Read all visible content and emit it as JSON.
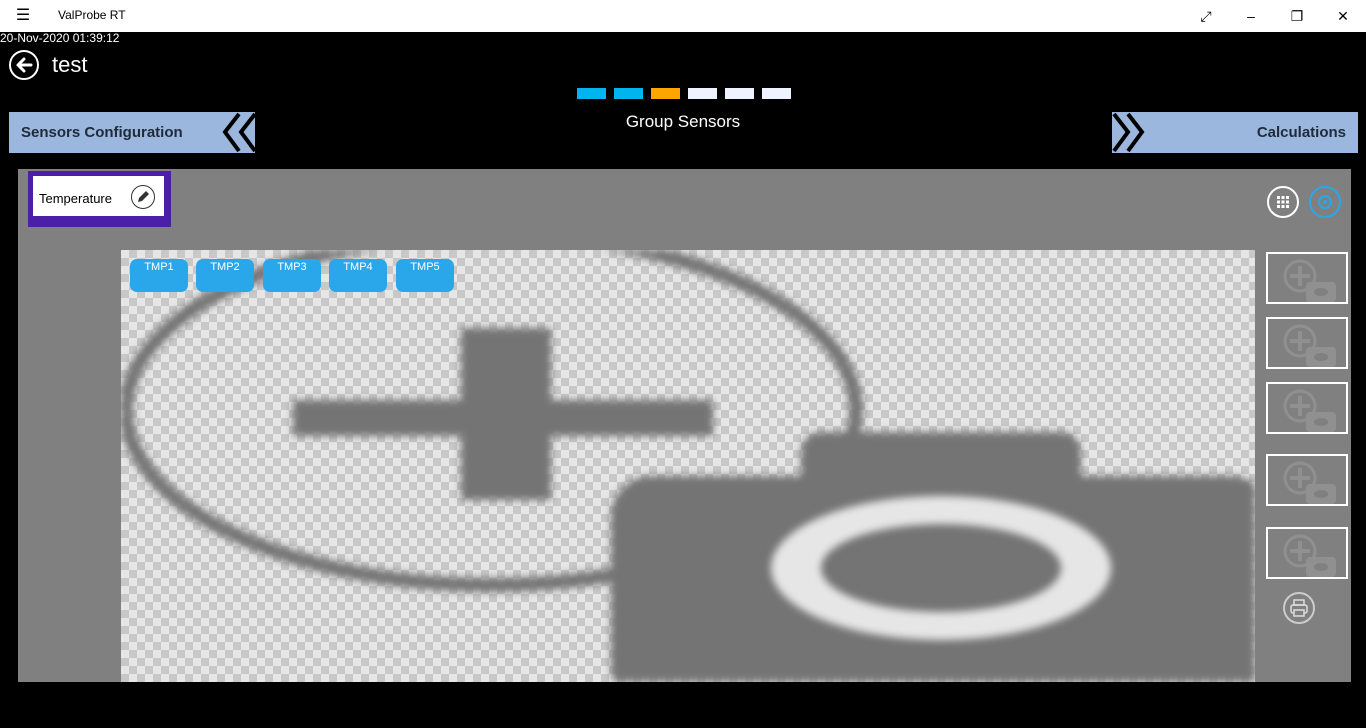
{
  "window": {
    "title": "ValProbe RT",
    "menu_icon": "hamburger-icon",
    "minimize": "–",
    "restore": "❐",
    "maximize": "⤢",
    "close": "✕"
  },
  "datetime": "20-Nov-2020 01:39:12",
  "page": {
    "title": "test"
  },
  "steps": {
    "colors": [
      "#00b4f0",
      "#00b4f0",
      "#ffa500",
      "#eef3ff",
      "#eef3ff",
      "#eef3ff"
    ],
    "current_index": 2
  },
  "nav": {
    "prev_label": "Sensors Configuration",
    "next_label": "Calculations",
    "stage_title": "Group Sensors"
  },
  "group": {
    "name": "Temperature"
  },
  "sensors": [
    "TMP1",
    "TMP2",
    "TMP3",
    "TMP4",
    "TMP5"
  ],
  "image_slots": {
    "count": 5,
    "icon": "add-photo-icon"
  },
  "toolbar": {
    "grid_icon": "grid-icon",
    "view_icon": "view-icon",
    "print_icon": "print-icon"
  }
}
